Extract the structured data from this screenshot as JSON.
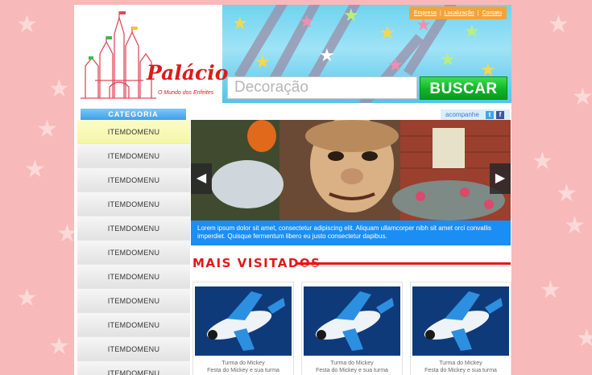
{
  "header": {
    "top_links": [
      "Empresa",
      "Localização",
      "Contato"
    ],
    "link_separator": "|",
    "logo_text": "Palácio",
    "logo_tagline": "O Mundo dos Enfeites"
  },
  "search": {
    "placeholder": "Decoração",
    "button_label": "BUSCAR"
  },
  "sidebar": {
    "heading": "CATEGORIA",
    "items": [
      "ITEMDOMENU",
      "ITEMDOMENU",
      "ITEMDOMENU",
      "ITEMDOMENU",
      "ITEMDOMENU",
      "ITEMDOMENU",
      "ITEMDOMENU",
      "ITEMDOMENU",
      "ITEMDOMENU",
      "ITEMDOMENU",
      "ITEMDOMENU"
    ]
  },
  "social": {
    "label": "acompanhe",
    "twitter_glyph": "t",
    "facebook_glyph": "f",
    "icons": [
      "twitter-icon",
      "facebook-icon"
    ]
  },
  "banner": {
    "caption": "Lorem ipsum dolor sit amet, consectetur adipiscing elit. Aliquam ullamcorper nibh sit amet orci convallis imperdiet. Quisque fermentum libero eu justo consectetur dapibus.",
    "prev_glyph": "◀",
    "next_glyph": "▶"
  },
  "most_visited": {
    "title": "MAIS VISITADOS",
    "products": [
      {
        "name": "Turma do Mickey",
        "desc": "Festa do Mickey e sua turma"
      },
      {
        "name": "Turma do Mickey",
        "desc": "Festa do Mickey e sua turma"
      },
      {
        "name": "Turma do Mickey",
        "desc": "Festa do Mickey e sua turma"
      }
    ]
  },
  "colors": {
    "accent_blue": "#1a8ef5",
    "buscar_green": "#10b528",
    "title_red": "#e01919",
    "links_orange": "#f6a23a",
    "page_pink": "#f7b9b9"
  }
}
